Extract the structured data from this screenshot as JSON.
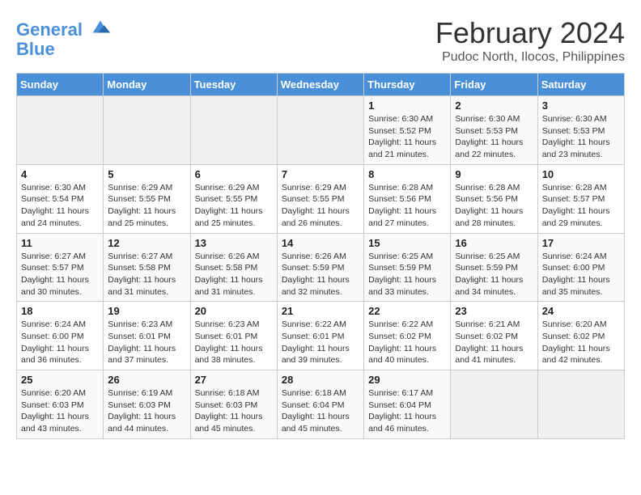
{
  "header": {
    "logo_line1": "General",
    "logo_line2": "Blue",
    "month": "February 2024",
    "location": "Pudoc North, Ilocos, Philippines"
  },
  "weekdays": [
    "Sunday",
    "Monday",
    "Tuesday",
    "Wednesday",
    "Thursday",
    "Friday",
    "Saturday"
  ],
  "weeks": [
    [
      {
        "day": "",
        "detail": ""
      },
      {
        "day": "",
        "detail": ""
      },
      {
        "day": "",
        "detail": ""
      },
      {
        "day": "",
        "detail": ""
      },
      {
        "day": "1",
        "detail": "Sunrise: 6:30 AM\nSunset: 5:52 PM\nDaylight: 11 hours\nand 21 minutes."
      },
      {
        "day": "2",
        "detail": "Sunrise: 6:30 AM\nSunset: 5:53 PM\nDaylight: 11 hours\nand 22 minutes."
      },
      {
        "day": "3",
        "detail": "Sunrise: 6:30 AM\nSunset: 5:53 PM\nDaylight: 11 hours\nand 23 minutes."
      }
    ],
    [
      {
        "day": "4",
        "detail": "Sunrise: 6:30 AM\nSunset: 5:54 PM\nDaylight: 11 hours\nand 24 minutes."
      },
      {
        "day": "5",
        "detail": "Sunrise: 6:29 AM\nSunset: 5:55 PM\nDaylight: 11 hours\nand 25 minutes."
      },
      {
        "day": "6",
        "detail": "Sunrise: 6:29 AM\nSunset: 5:55 PM\nDaylight: 11 hours\nand 25 minutes."
      },
      {
        "day": "7",
        "detail": "Sunrise: 6:29 AM\nSunset: 5:55 PM\nDaylight: 11 hours\nand 26 minutes."
      },
      {
        "day": "8",
        "detail": "Sunrise: 6:28 AM\nSunset: 5:56 PM\nDaylight: 11 hours\nand 27 minutes."
      },
      {
        "day": "9",
        "detail": "Sunrise: 6:28 AM\nSunset: 5:56 PM\nDaylight: 11 hours\nand 28 minutes."
      },
      {
        "day": "10",
        "detail": "Sunrise: 6:28 AM\nSunset: 5:57 PM\nDaylight: 11 hours\nand 29 minutes."
      }
    ],
    [
      {
        "day": "11",
        "detail": "Sunrise: 6:27 AM\nSunset: 5:57 PM\nDaylight: 11 hours\nand 30 minutes."
      },
      {
        "day": "12",
        "detail": "Sunrise: 6:27 AM\nSunset: 5:58 PM\nDaylight: 11 hours\nand 31 minutes."
      },
      {
        "day": "13",
        "detail": "Sunrise: 6:26 AM\nSunset: 5:58 PM\nDaylight: 11 hours\nand 31 minutes."
      },
      {
        "day": "14",
        "detail": "Sunrise: 6:26 AM\nSunset: 5:59 PM\nDaylight: 11 hours\nand 32 minutes."
      },
      {
        "day": "15",
        "detail": "Sunrise: 6:25 AM\nSunset: 5:59 PM\nDaylight: 11 hours\nand 33 minutes."
      },
      {
        "day": "16",
        "detail": "Sunrise: 6:25 AM\nSunset: 5:59 PM\nDaylight: 11 hours\nand 34 minutes."
      },
      {
        "day": "17",
        "detail": "Sunrise: 6:24 AM\nSunset: 6:00 PM\nDaylight: 11 hours\nand 35 minutes."
      }
    ],
    [
      {
        "day": "18",
        "detail": "Sunrise: 6:24 AM\nSunset: 6:00 PM\nDaylight: 11 hours\nand 36 minutes."
      },
      {
        "day": "19",
        "detail": "Sunrise: 6:23 AM\nSunset: 6:01 PM\nDaylight: 11 hours\nand 37 minutes."
      },
      {
        "day": "20",
        "detail": "Sunrise: 6:23 AM\nSunset: 6:01 PM\nDaylight: 11 hours\nand 38 minutes."
      },
      {
        "day": "21",
        "detail": "Sunrise: 6:22 AM\nSunset: 6:01 PM\nDaylight: 11 hours\nand 39 minutes."
      },
      {
        "day": "22",
        "detail": "Sunrise: 6:22 AM\nSunset: 6:02 PM\nDaylight: 11 hours\nand 40 minutes."
      },
      {
        "day": "23",
        "detail": "Sunrise: 6:21 AM\nSunset: 6:02 PM\nDaylight: 11 hours\nand 41 minutes."
      },
      {
        "day": "24",
        "detail": "Sunrise: 6:20 AM\nSunset: 6:02 PM\nDaylight: 11 hours\nand 42 minutes."
      }
    ],
    [
      {
        "day": "25",
        "detail": "Sunrise: 6:20 AM\nSunset: 6:03 PM\nDaylight: 11 hours\nand 43 minutes."
      },
      {
        "day": "26",
        "detail": "Sunrise: 6:19 AM\nSunset: 6:03 PM\nDaylight: 11 hours\nand 44 minutes."
      },
      {
        "day": "27",
        "detail": "Sunrise: 6:18 AM\nSunset: 6:03 PM\nDaylight: 11 hours\nand 45 minutes."
      },
      {
        "day": "28",
        "detail": "Sunrise: 6:18 AM\nSunset: 6:04 PM\nDaylight: 11 hours\nand 45 minutes."
      },
      {
        "day": "29",
        "detail": "Sunrise: 6:17 AM\nSunset: 6:04 PM\nDaylight: 11 hours\nand 46 minutes."
      },
      {
        "day": "",
        "detail": ""
      },
      {
        "day": "",
        "detail": ""
      }
    ]
  ]
}
